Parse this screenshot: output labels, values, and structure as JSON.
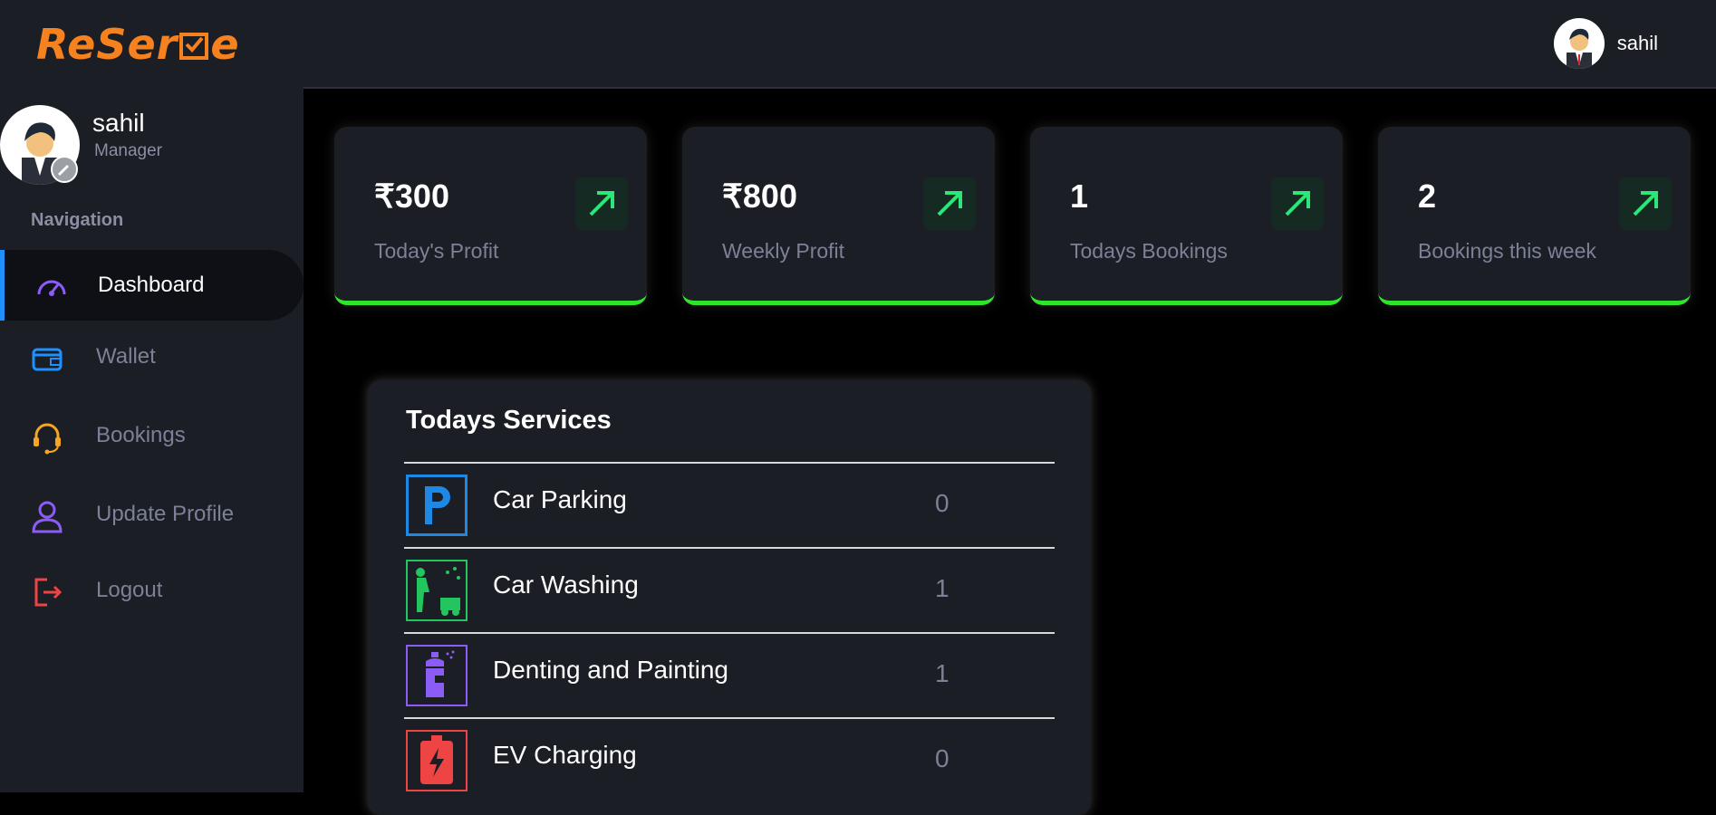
{
  "app": {
    "logo_text_a": "ReSer",
    "logo_text_b": "e"
  },
  "topbar": {
    "username": "sahil"
  },
  "sidebar": {
    "profile_name": "sahil",
    "profile_role": "Manager",
    "nav_heading": "Navigation",
    "items": [
      {
        "label": "Dashboard",
        "icon": "speedometer-icon",
        "color": "#8b5cf6",
        "active": true
      },
      {
        "label": "Wallet",
        "icon": "wallet-icon",
        "color": "#1e90ff"
      },
      {
        "label": "Bookings",
        "icon": "headset-icon",
        "color": "#f5a623"
      },
      {
        "label": "Update Profile",
        "icon": "user-icon",
        "color": "#8b5cf6"
      },
      {
        "label": "Logout",
        "icon": "logout-icon",
        "color": "#ef4444"
      }
    ]
  },
  "cards": [
    {
      "value": "₹300",
      "label": "Today's Profit"
    },
    {
      "value": "₹800",
      "label": "Weekly Profit"
    },
    {
      "value": "1",
      "label": "Todays Bookings"
    },
    {
      "value": "2",
      "label": "Bookings this week"
    }
  ],
  "colors": {
    "accent_green": "#2ee52a",
    "logo_orange": "#f5821f",
    "active_border": "#1e90ff"
  },
  "services": {
    "title": "Todays Services",
    "rows": [
      {
        "name": "Car Parking",
        "count": "0",
        "icon": "parking-icon",
        "color": "#1e88e5"
      },
      {
        "name": "Car Washing",
        "count": "1",
        "icon": "car-wash-icon",
        "color": "#22c55e"
      },
      {
        "name": "Denting and Painting",
        "count": "1",
        "icon": "spray-paint-icon",
        "color": "#8b5cf6"
      },
      {
        "name": "EV Charging",
        "count": "0",
        "icon": "battery-charging-icon",
        "color": "#ef4444"
      }
    ]
  }
}
